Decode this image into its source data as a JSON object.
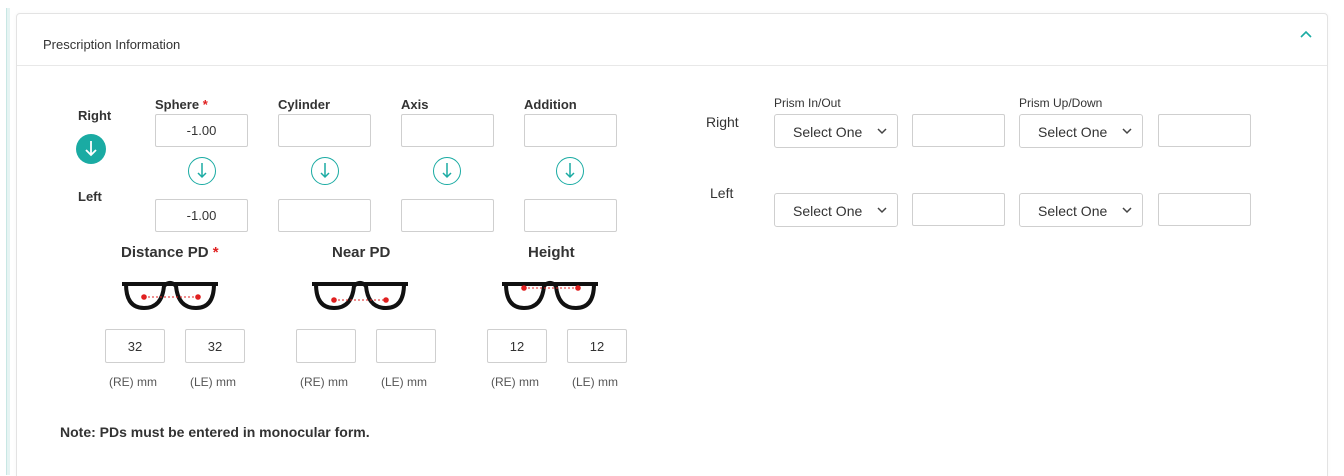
{
  "header": {
    "title": "Prescription Information"
  },
  "eyes": {
    "right": "Right",
    "left": "Left"
  },
  "columns": {
    "sphere": "Sphere",
    "cylinder": "Cylinder",
    "axis": "Axis",
    "addition": "Addition",
    "required_mark": "*"
  },
  "values": {
    "right_sphere": "-1.00",
    "left_sphere": "-1.00",
    "right_cylinder": "",
    "left_cylinder": "",
    "right_axis": "",
    "left_axis": "",
    "right_addition": "",
    "left_addition": ""
  },
  "prism": {
    "in_out_label": "Prism In/Out",
    "up_down_label": "Prism Up/Down",
    "select_placeholder": "Select One",
    "right_in_out_value": "",
    "right_up_down_value": "",
    "left_in_out_value": "",
    "left_up_down_value": ""
  },
  "pd": {
    "distance_title": "Distance PD",
    "near_title": "Near PD",
    "height_title": "Height",
    "distance_re": "32",
    "distance_le": "32",
    "near_re": "",
    "near_le": "",
    "height_re": "12",
    "height_le": "12",
    "re_unit": "(RE) mm",
    "le_unit": "(LE) mm"
  },
  "note": "Note: PDs must be entered in monocular form.",
  "colors": {
    "accent": "#1aaba3",
    "required": "#e02020",
    "dot": "#e02020"
  },
  "icons": {
    "collapse": "chevron-up-icon",
    "copy_down": "arrow-down-circle-icon",
    "glasses": "glasses-icon"
  }
}
